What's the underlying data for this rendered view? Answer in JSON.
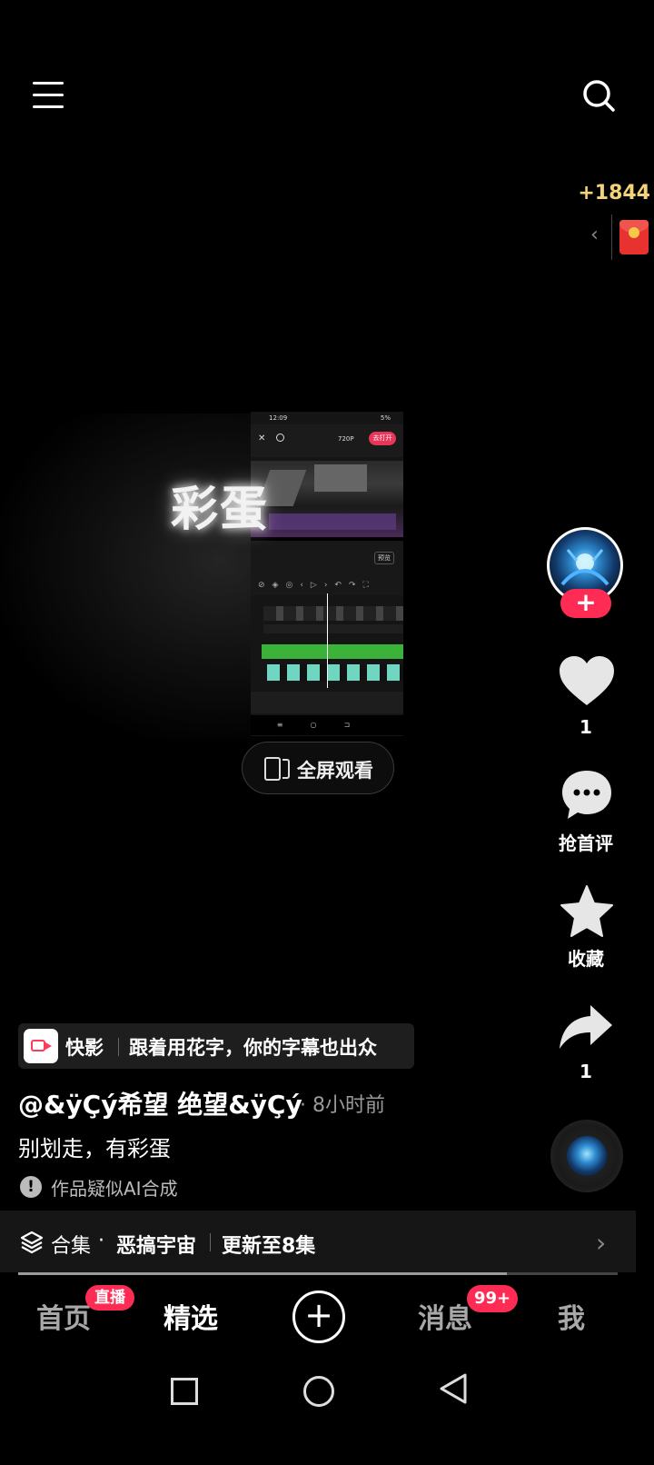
{
  "top": {
    "menu_icon": "hamburger-menu-icon",
    "search_icon": "search-icon",
    "reward_count": "+1844",
    "reward_chevron": "‹",
    "red_envelope_icon": "red-envelope-icon"
  },
  "video": {
    "overlay_text": "彩蛋",
    "phone": {
      "status_time": "12:09",
      "status_right": "5%",
      "resolution": "720P",
      "done_button": "去打开",
      "select_label": "预览"
    },
    "fullscreen_label": "全屏观看"
  },
  "side": {
    "like_count": "1",
    "comment_label": "抢首评",
    "collect_label": "收藏",
    "share_count": "1",
    "follow_label": "+"
  },
  "info": {
    "app_name": "快影",
    "app_slogan": "跟着用花字，你的字幕也出众",
    "author": "@&ÿÇý希望  绝望&ÿÇý",
    "post_time": "· 8小时前",
    "description": "别划走，有彩蛋",
    "ai_notice_icon": "!",
    "ai_notice": "作品疑似AI合成",
    "collection": {
      "label": "合集",
      "dot": "·",
      "name": "恶搞宇宙",
      "update": "更新至8集",
      "chevron": "›"
    },
    "progress": 0.815
  },
  "tabs": {
    "home": "首页",
    "live_badge": "直播",
    "featured": "精选",
    "add": "+",
    "messages": "消息",
    "messages_badge": "99+",
    "me": "我"
  },
  "colors": {
    "accent": "#fe2c55",
    "reward": "#f3d27a",
    "background": "#000000"
  }
}
